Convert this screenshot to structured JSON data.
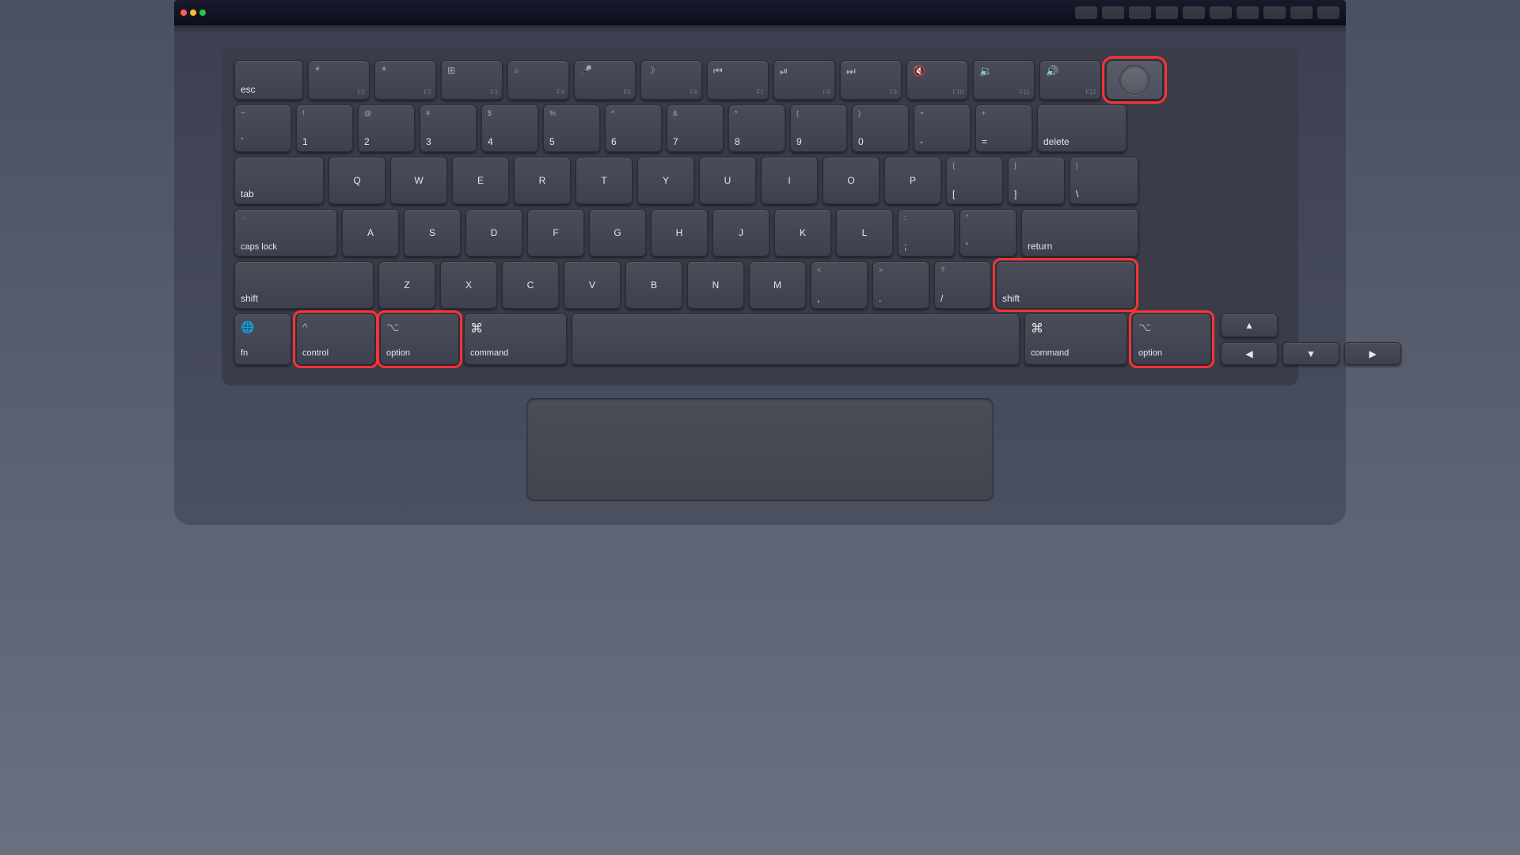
{
  "laptop": {
    "screen_bar_color": "#0d0d1a",
    "keyboard_color": "#3a3d48",
    "key_color": "#4a4d58"
  },
  "keys": {
    "esc": "esc",
    "f1_sym": "☀",
    "f1": "F1",
    "f2_sym": "☀",
    "f2": "F2",
    "f3_sym": "⊞",
    "f3": "F3",
    "f4_sym": "🔍",
    "f4": "F4",
    "f5_sym": "🎤",
    "f5": "F5",
    "f6_sym": "☽",
    "f6": "F6",
    "f7_sym": "⏮",
    "f7": "F7",
    "f8_sym": "⏯",
    "f8": "F8",
    "f9_sym": "⏭",
    "f9": "F9",
    "f10_sym": "🔇",
    "f10": "F10",
    "f11_sym": "🔉",
    "f11": "F11",
    "f12_sym": "🔊",
    "f12": "F12",
    "delete": "delete",
    "tab": "tab",
    "caps_lock": "caps lock",
    "return": "return",
    "shift": "shift",
    "fn": "fn",
    "control": "control",
    "option": "option",
    "command": "command",
    "space": "",
    "highlighted_keys": [
      "control",
      "option-left",
      "power",
      "shift-right",
      "option-right"
    ]
  }
}
